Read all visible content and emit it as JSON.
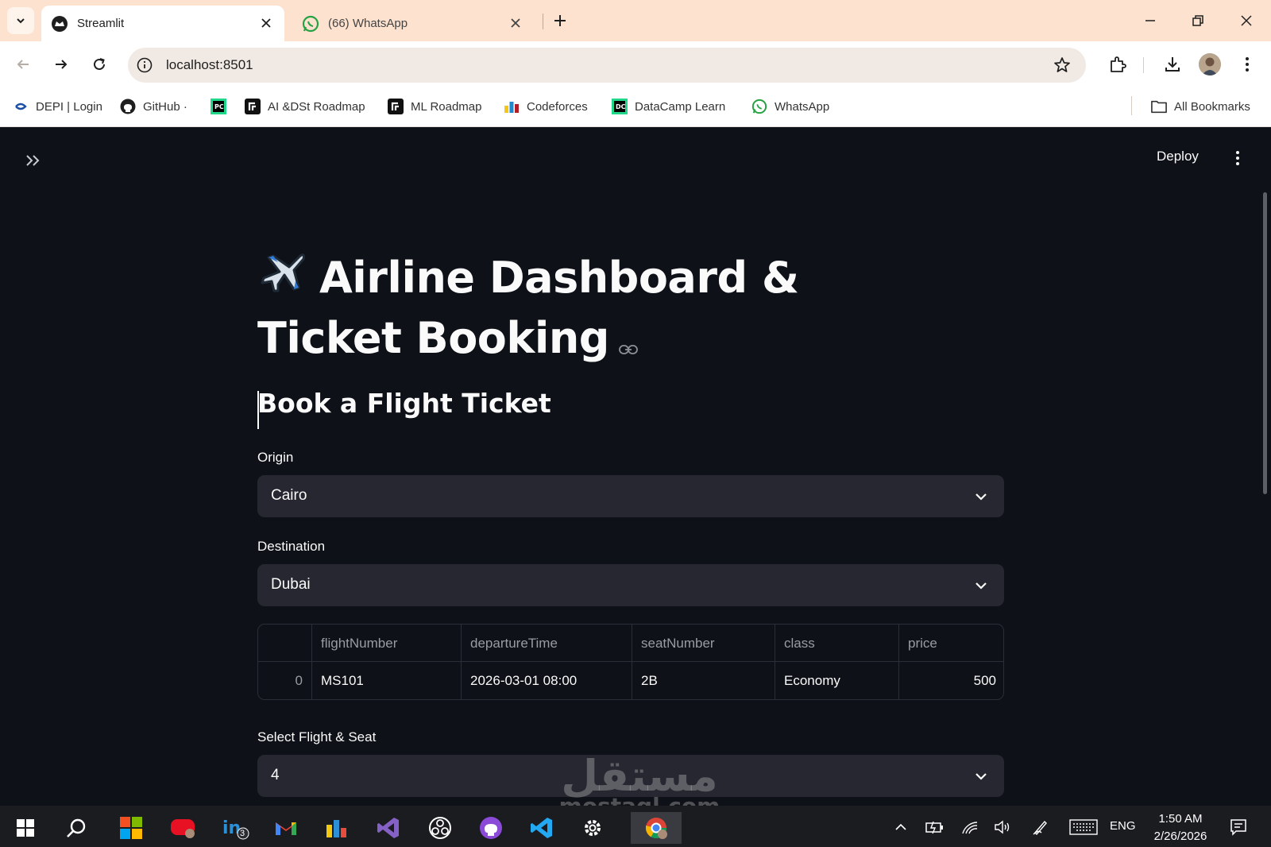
{
  "browser": {
    "tabs": [
      {
        "label": "Streamlit",
        "active": true
      },
      {
        "label": "(66) WhatsApp",
        "active": false
      }
    ],
    "url": "localhost:8501",
    "bookmarks": [
      {
        "label": "DEPI | Login",
        "icon": "depi-icon"
      },
      {
        "label": "GitHub ·",
        "icon": "github-icon"
      },
      {
        "label": "",
        "icon": "pycharm-icon"
      },
      {
        "label": "AI &DSt Roadmap",
        "icon": "roadmap-icon"
      },
      {
        "label": "ML Roadmap",
        "icon": "roadmap-icon"
      },
      {
        "label": "Codeforces",
        "icon": "codeforces-icon"
      },
      {
        "label": "DataCamp Learn",
        "icon": "datacamp-icon"
      },
      {
        "label": "WhatsApp",
        "icon": "whatsapp-icon"
      }
    ],
    "all_bookmarks_label": "All Bookmarks"
  },
  "app": {
    "deploy_label": "Deploy",
    "title": "Airline Dashboard & Ticket Booking",
    "title_emoji": "airplane-icon",
    "subheader": "Book a Flight Ticket",
    "origin": {
      "label": "Origin",
      "value": "Cairo"
    },
    "destination": {
      "label": "Destination",
      "value": "Dubai"
    },
    "table": {
      "columns": [
        "",
        "flightNumber",
        "departureTime",
        "seatNumber",
        "class",
        "price"
      ],
      "rows": [
        {
          "index": "0",
          "flightNumber": "MS101",
          "departureTime": "2026-03-01 08:00",
          "seatNumber": "2B",
          "class": "Economy",
          "price": "500"
        }
      ]
    },
    "flight_seat": {
      "label": "Select Flight & Seat",
      "value": "4"
    }
  },
  "watermark": {
    "arabic": "مستقل",
    "latin": "mostaql.com"
  },
  "taskbar": {
    "lang": "ENG",
    "time": "1:50 AM",
    "date": "2/26/2026",
    "linkedin_badge": "3"
  },
  "colors": {
    "app_bg": "#0e1117",
    "widget_bg": "#262730",
    "tabbar_bg": "#fde2cf",
    "taskbar_bg": "#1b1c20",
    "accent": "#ff4b4b"
  }
}
